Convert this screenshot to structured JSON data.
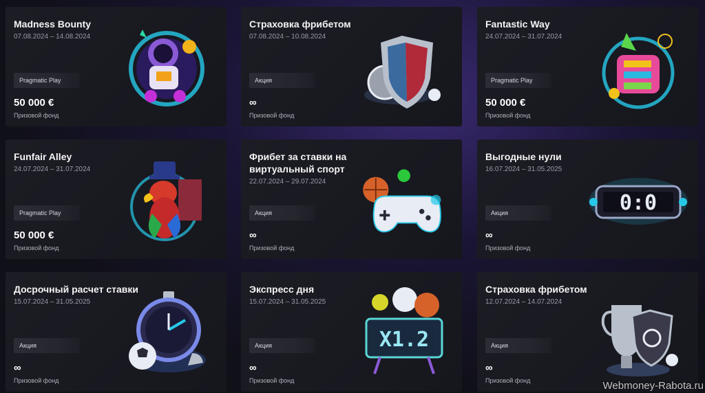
{
  "cards": [
    {
      "title": "Madness Bounty",
      "dates": "07.08.2024 – 14.08.2024",
      "tag": "Pragmatic Play",
      "amount": "50 000 €",
      "fund_label": "Призовой фонд",
      "art": "astronaut-icon"
    },
    {
      "title": "Страховка фрибетом",
      "dates": "07.08.2024 – 10.08.2024",
      "tag": "Акция",
      "amount": "∞",
      "fund_label": "Призовой фонд",
      "art": "shield-icon"
    },
    {
      "title": "Fantastic Way",
      "dates": "24.07.2024 – 31.07.2024",
      "tag": "Pragmatic Play",
      "amount": "50 000 €",
      "fund_label": "Призовой фонд",
      "art": "pinata-icon"
    },
    {
      "title": "Funfair Alley",
      "dates": "24.07.2024 – 31.07.2024",
      "tag": "Pragmatic Play",
      "amount": "50 000 €",
      "fund_label": "Призовой фонд",
      "art": "parrot-icon"
    },
    {
      "title": "Фрибет за ставки на виртуальный спорт",
      "dates": "22.07.2024 – 29.07.2024",
      "tag": "Акция",
      "amount": "∞",
      "fund_label": "Призовой фонд",
      "art": "gamepad-icon"
    },
    {
      "title": "Выгодные нули",
      "dates": "16.07.2024 – 31.05.2025",
      "tag": "Акция",
      "amount": "∞",
      "fund_label": "Призовой фонд",
      "art": "scoreboard-icon"
    },
    {
      "title": "Досрочный расчет ставки",
      "dates": "15.07.2024 – 31.05.2025",
      "tag": "Акция",
      "amount": "∞",
      "fund_label": "Призовой фонд",
      "art": "stopwatch-icon"
    },
    {
      "title": "Экспресс дня",
      "dates": "15.07.2024 – 31.05.2025",
      "tag": "Акция",
      "amount": "∞",
      "fund_label": "Призовой фонд",
      "art": "odds-board-icon"
    },
    {
      "title": "Страховка фрибетом",
      "dates": "12.07.2024 – 14.07.2024",
      "tag": "Акция",
      "amount": "∞",
      "fund_label": "Призовой фонд",
      "art": "trophy-shield-icon"
    }
  ],
  "scoreboard_text": "0:0",
  "odds_text": "X1.2",
  "watermark": "Webmoney-Rabota.ru"
}
